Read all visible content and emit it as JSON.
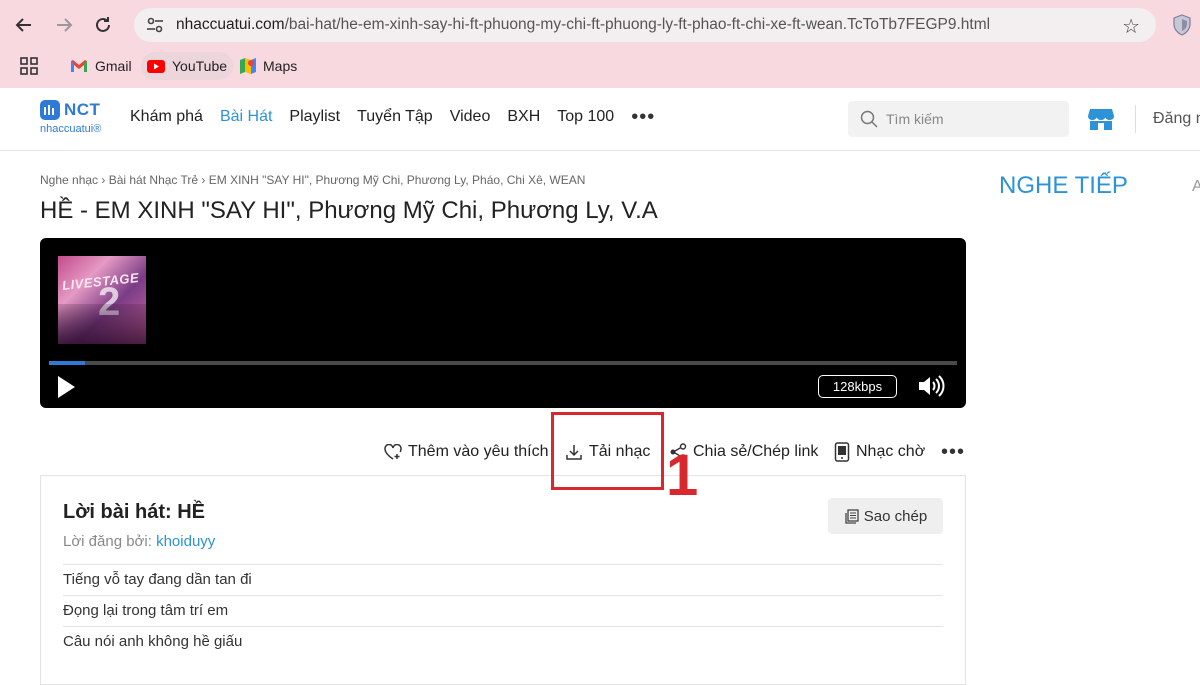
{
  "browser": {
    "url_host": "nhaccuatui.com",
    "url_path": "/bai-hat/he-em-xinh-say-hi-ft-phuong-my-chi-ft-phuong-ly-ft-phao-ft-chi-xe-ft-wean.TcToTb7FEGP9.html",
    "bookmarks": [
      {
        "label": "Gmail",
        "icon": "gmail-icon"
      },
      {
        "label": "YouTube",
        "icon": "youtube-icon"
      },
      {
        "label": "Maps",
        "icon": "maps-icon"
      }
    ]
  },
  "site": {
    "logo_text": "NCT",
    "logo_sub": "nhaccuatui®",
    "nav": [
      "Khám phá",
      "Bài Hát",
      "Playlist",
      "Tuyển Tập",
      "Video",
      "BXH",
      "Top 100"
    ],
    "nav_current": "Bài Hát",
    "search_placeholder": "Tìm kiếm",
    "login_label": "Đăng n"
  },
  "breadcrumb": "Nghe nhạc › Bài hát Nhạc Trẻ › EM XINH \"SAY HI\", Phương Mỹ Chi, Phương Ly, Pháo, Chi Xê, WEAN",
  "song_title": "HỀ - EM XINH \"SAY HI\", Phương Mỹ Chi, Phương Ly, V.A",
  "player": {
    "bitrate": "128kbps",
    "progress": 0.006,
    "accent": "#2d7bd6"
  },
  "actions": {
    "favorite": "Thêm vào yêu thích",
    "download": "Tải nhạc",
    "share": "Chia sẻ/Chép link",
    "ringtone": "Nhạc chờ"
  },
  "annotation": {
    "step": "1",
    "color": "#d9272e"
  },
  "lyrics": {
    "title": "Lời bài hát: HỀ",
    "posted_by_label": "Lời đăng bởi:",
    "posted_by_user": "khoiduyy",
    "copy_label": "Sao chép",
    "lines": [
      "Tiếng vỗ tay đang dần tan đi",
      "Đọng lại trong tâm trí em",
      "Câu nói anh không hề giấu"
    ]
  },
  "sidebar": {
    "title": "NGHE TIẾP",
    "cut_letter": "A"
  }
}
